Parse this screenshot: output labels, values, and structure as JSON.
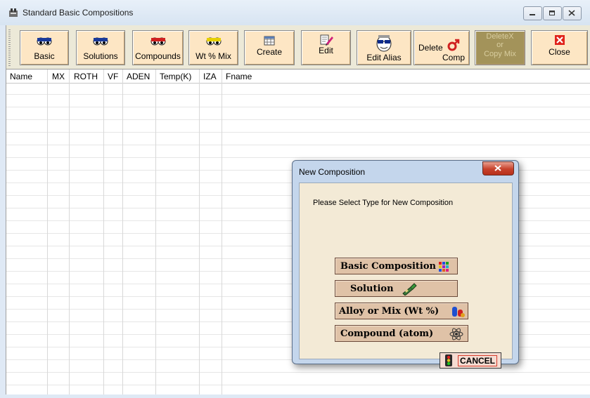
{
  "window": {
    "title": "Standard Basic Compositions"
  },
  "toolbar": {
    "basic": "Basic",
    "solutions": "Solutions",
    "compounds": "Compounds",
    "wt_mix": "Wt % Mix",
    "create": "Create",
    "edit": "Edit",
    "edit_alias": "Edit Alias",
    "delete_comp_line1": "Delete",
    "delete_comp_line2": "Comp",
    "delete_copy_line1": "DeleteX",
    "delete_copy_line2": "or",
    "delete_copy_line3": "Copy Mix",
    "close": "Close"
  },
  "grid": {
    "columns": [
      "Name",
      "MX",
      "ROTH",
      "VF",
      "ADEN",
      "Temp(K)",
      "IZA",
      "Fname"
    ]
  },
  "dialog": {
    "title": "New Composition",
    "prompt": "Please Select Type for New Composition",
    "options": [
      "Basic Composition",
      "Solution",
      "Alloy or Mix (Wt %)",
      "Compound (atom)"
    ],
    "cancel": "CANCEL"
  },
  "colors": {
    "toolbar_button": "#fde6c4",
    "toolbar_disabled": "#a3935a",
    "dialog_body": "#f3ead6",
    "option_button": "#dfc2a7",
    "close_red": "#c7412b"
  }
}
